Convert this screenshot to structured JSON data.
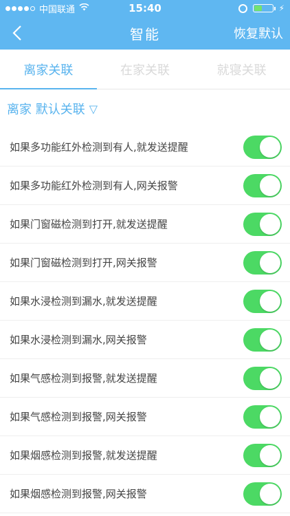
{
  "status": {
    "carrier": "中国联通",
    "time": "15:40"
  },
  "nav": {
    "title": "智能",
    "right_action": "恢复默认"
  },
  "tabs": [
    {
      "label": "离家关联",
      "active": true
    },
    {
      "label": "在家关联",
      "active": false
    },
    {
      "label": "就寝关联",
      "active": false
    }
  ],
  "section": {
    "title": "离家 默认关联",
    "caret": "▽"
  },
  "rules": [
    {
      "label": "如果多功能红外检测到有人,就发送提醒",
      "enabled": true
    },
    {
      "label": "如果多功能红外检测到有人,网关报警",
      "enabled": true
    },
    {
      "label": "如果门窗磁检测到打开,就发送提醒",
      "enabled": true
    },
    {
      "label": "如果门窗磁检测到打开,网关报警",
      "enabled": true
    },
    {
      "label": "如果水浸检测到漏水,就发送提醒",
      "enabled": true
    },
    {
      "label": "如果水浸检测到漏水,网关报警",
      "enabled": true
    },
    {
      "label": "如果气感检测到报警,就发送提醒",
      "enabled": true
    },
    {
      "label": "如果气感检测到报警,网关报警",
      "enabled": true
    },
    {
      "label": "如果烟感检测到报警,就发送提醒",
      "enabled": true
    },
    {
      "label": "如果烟感检测到报警,网关报警",
      "enabled": true
    }
  ],
  "colors": {
    "header": "#5fb7f1",
    "accent": "#58b3ee",
    "toggle_on": "#4cd964"
  }
}
